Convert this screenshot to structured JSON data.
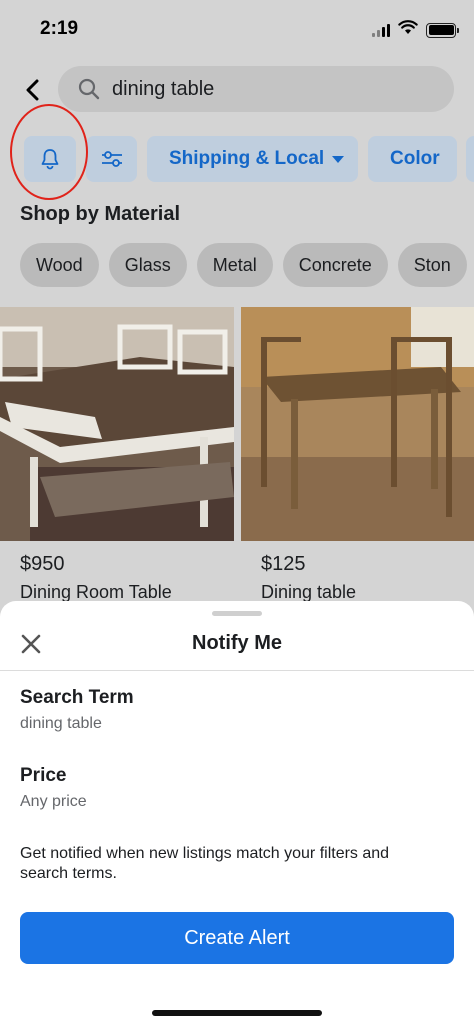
{
  "status_bar": {
    "time": "2:19"
  },
  "search": {
    "query": "dining table"
  },
  "filters": {
    "chips": [
      "Shipping & Local",
      "Color"
    ]
  },
  "shop_by_material": {
    "title": "Shop by Material",
    "materials": [
      "Wood",
      "Glass",
      "Metal",
      "Concrete",
      "Ston"
    ]
  },
  "listings": [
    {
      "price": "$950",
      "title": "Dining Room Table"
    },
    {
      "price": "$125",
      "title": "Dining table"
    }
  ],
  "notify_sheet": {
    "title": "Notify Me",
    "search_term_label": "Search Term",
    "search_term_value": "dining table",
    "price_label": "Price",
    "price_value": "Any price",
    "hint": "Get notified when new listings match your filters and search terms.",
    "create_button": "Create Alert"
  },
  "colors": {
    "accent": "#1b74e4",
    "chip_text": "#1467c8",
    "annotation": "#e0231a"
  },
  "icons": [
    "back-icon",
    "search-icon",
    "bell-icon",
    "filter-sliders-icon",
    "close-icon",
    "wifi-icon",
    "signal-icon",
    "battery-icon"
  ]
}
